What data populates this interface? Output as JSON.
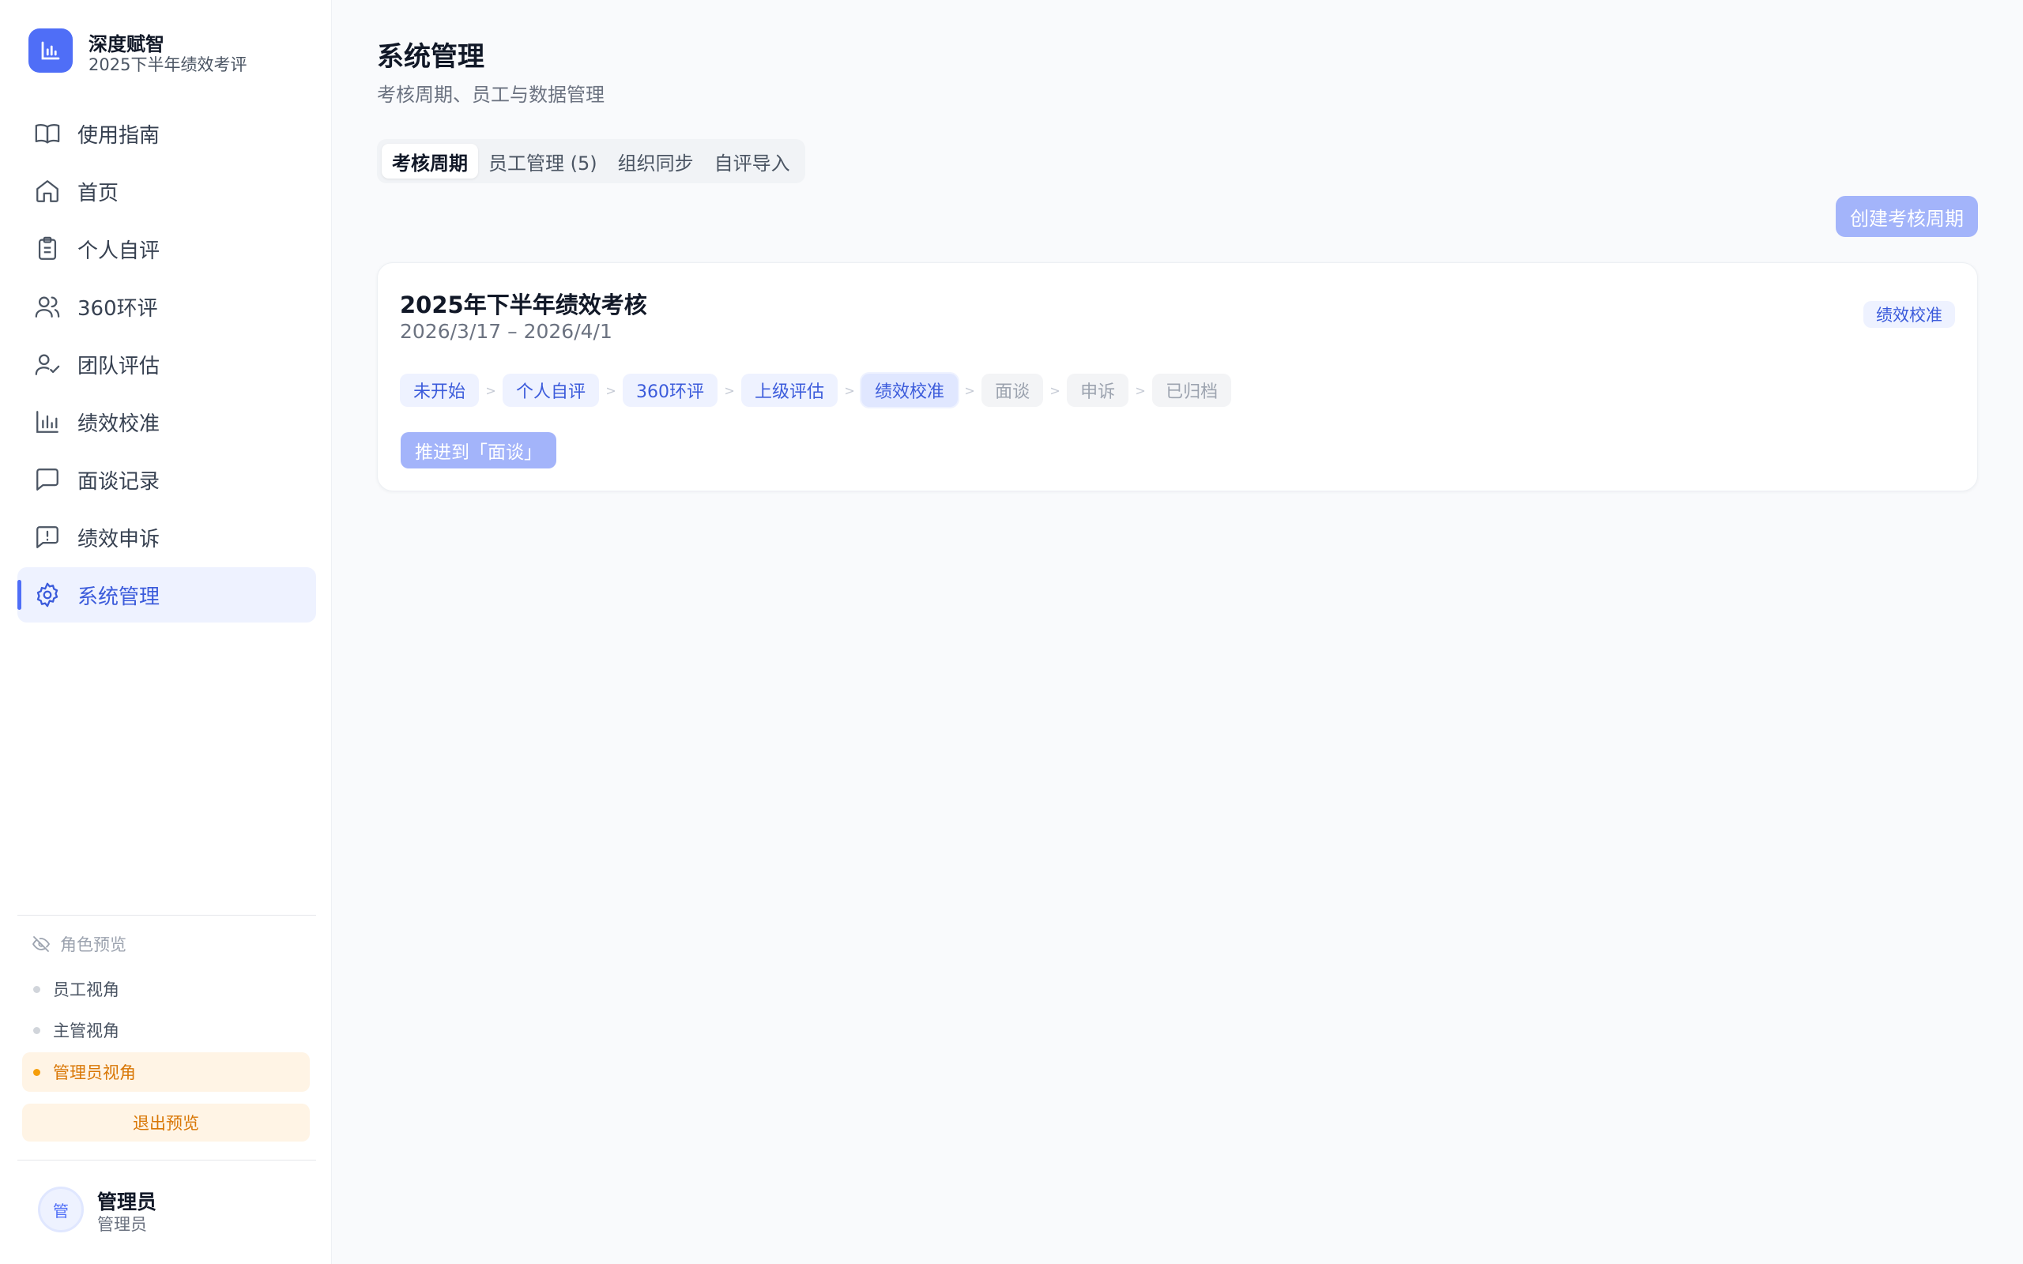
{
  "brand": {
    "name": "深度赋智",
    "subtitle": "2025下半年绩效考评"
  },
  "nav": {
    "items": [
      {
        "label": "使用指南",
        "icon": "book-open-icon"
      },
      {
        "label": "首页",
        "icon": "home-icon"
      },
      {
        "label": "个人自评",
        "icon": "clipboard-icon"
      },
      {
        "label": "360环评",
        "icon": "users-icon"
      },
      {
        "label": "团队评估",
        "icon": "user-check-icon"
      },
      {
        "label": "绩效校准",
        "icon": "bar-chart-icon"
      },
      {
        "label": "面谈记录",
        "icon": "message-square-icon"
      },
      {
        "label": "绩效申诉",
        "icon": "message-alert-icon"
      },
      {
        "label": "系统管理",
        "icon": "gear-icon",
        "active": true
      }
    ]
  },
  "role_preview": {
    "title": "角色预览",
    "roles": [
      {
        "label": "员工视角"
      },
      {
        "label": "主管视角"
      },
      {
        "label": "管理员视角",
        "active": true
      }
    ],
    "exit_label": "退出预览"
  },
  "user": {
    "avatar": "管",
    "name": "管理员",
    "role": "管理员"
  },
  "page": {
    "title": "系统管理",
    "subtitle": "考核周期、员工与数据管理"
  },
  "tabs": [
    {
      "label": "考核周期",
      "active": true
    },
    {
      "label": "员工管理 (5)"
    },
    {
      "label": "组织同步"
    },
    {
      "label": "自评导入"
    }
  ],
  "actions": {
    "create_label": "创建考核周期"
  },
  "cycle": {
    "title": "2025年下半年绩效考核",
    "dates": "2026/3/17 – 2026/4/1",
    "badge": "绩效校准",
    "stages": [
      {
        "label": "未开始",
        "state": "done"
      },
      {
        "label": "个人自评",
        "state": "done"
      },
      {
        "label": "360环评",
        "state": "done"
      },
      {
        "label": "上级评估",
        "state": "done"
      },
      {
        "label": "绩效校准",
        "state": "current"
      },
      {
        "label": "面谈",
        "state": "todo"
      },
      {
        "label": "申诉",
        "state": "todo"
      },
      {
        "label": "已归档",
        "state": "todo"
      }
    ],
    "advance_label": "推进到「面谈」"
  },
  "colors": {
    "accent": "#4f6ef7",
    "accent_soft": "#eef2ff",
    "warning": "#d97706",
    "warning_soft": "#fff4e5",
    "button_disabled": "#a3b4fa"
  }
}
